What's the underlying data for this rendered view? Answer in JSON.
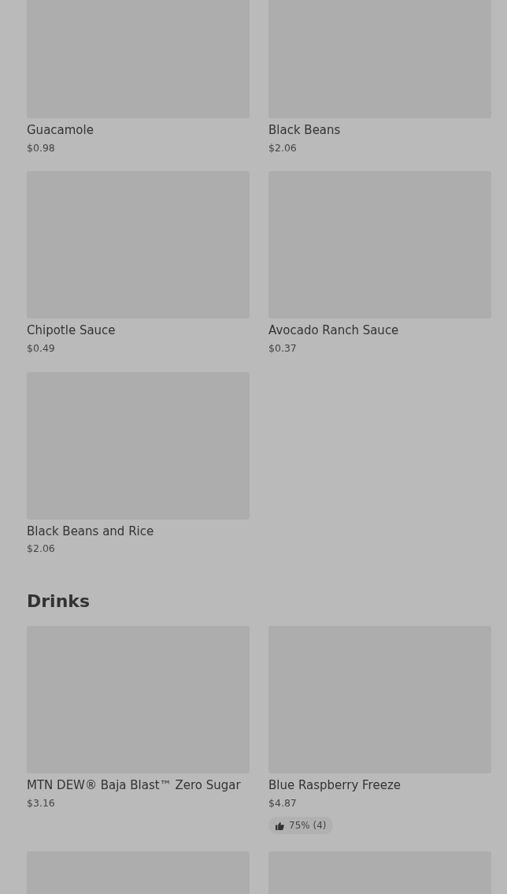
{
  "sections": [
    {
      "items": [
        {
          "kind": "product",
          "name": "Guacamole",
          "price": "$0.98"
        },
        {
          "kind": "product",
          "name": "Black Beans",
          "price": "$2.06"
        },
        {
          "kind": "product",
          "name": "Chipotle Sauce",
          "price": "$0.49"
        },
        {
          "kind": "product",
          "name": "Avocado Ranch Sauce",
          "price": "$0.37"
        },
        {
          "kind": "product",
          "name": "Black Beans and Rice",
          "price": "$2.06"
        }
      ]
    },
    {
      "title": "Drinks",
      "items": [
        {
          "kind": "product",
          "name": "MTN DEW® Baja Blast™ Zero Sugar",
          "price": "$3.16"
        },
        {
          "kind": "product",
          "name": "Blue Raspberry Freeze",
          "price": "$4.87",
          "rating": "75% (4)"
        },
        {
          "kind": "cut_off"
        },
        {
          "kind": "cut_off"
        }
      ]
    }
  ]
}
